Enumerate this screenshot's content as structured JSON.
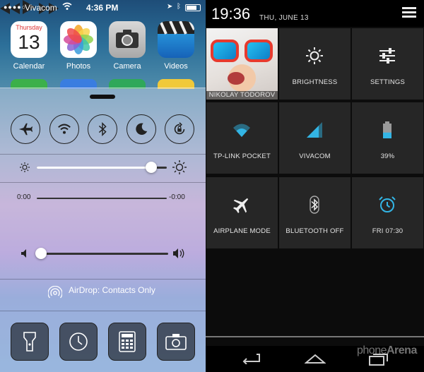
{
  "ios": {
    "status_bar": {
      "signal": "●●●●○",
      "carrier": "Vivacom",
      "time": "4:36 PM"
    },
    "apps": [
      {
        "label": "Calendar",
        "day": "Thursday",
        "date": "13"
      },
      {
        "label": "Photos"
      },
      {
        "label": "Camera"
      },
      {
        "label": "Videos"
      }
    ],
    "toggles": [
      {
        "name": "airplane",
        "on": false
      },
      {
        "name": "wifi",
        "on": false
      },
      {
        "name": "bluetooth",
        "on": false
      },
      {
        "name": "do-not-disturb",
        "on": false
      },
      {
        "name": "rotation-lock",
        "on": false
      }
    ],
    "brightness_level": 0.88,
    "media": {
      "elapsed": "0:00",
      "remaining": "-0:00",
      "volume_level": 0.04
    },
    "airdrop_label": "AirDrop: Contacts Only",
    "quick_launch": [
      "flashlight-icon",
      "clock-icon",
      "calculator-icon",
      "camera-icon"
    ],
    "colors": {
      "airdrop_text": "#ffffff",
      "toggle_border": "#222222"
    }
  },
  "android": {
    "time": "19:36",
    "date": "THU, JUNE 13",
    "tiles": [
      {
        "id": "profile",
        "label": "NIKOLAY TODOROV"
      },
      {
        "id": "brightness",
        "label": "BRIGHTNESS",
        "icon": "brightness-icon"
      },
      {
        "id": "settings",
        "label": "SETTINGS",
        "icon": "settings-sliders-icon"
      },
      {
        "id": "wifi",
        "label": "TP-LINK POCKET",
        "icon": "wifi-icon"
      },
      {
        "id": "cell",
        "label": "VIVACOM",
        "icon": "cell-signal-icon"
      },
      {
        "id": "battery",
        "label": "39%",
        "icon": "battery-icon",
        "level": 0.39
      },
      {
        "id": "airplane",
        "label": "AIRPLANE MODE",
        "icon": "airplane-icon"
      },
      {
        "id": "bluetooth",
        "label": "BLUETOOTH OFF",
        "icon": "bluetooth-icon"
      },
      {
        "id": "alarm",
        "label": "FRI 07:30",
        "icon": "alarm-icon"
      }
    ],
    "colors": {
      "accent": "#33b5e5",
      "tile_bg": "#262626"
    },
    "watermark": {
      "phone": "phone",
      "arena": "Arena"
    }
  }
}
